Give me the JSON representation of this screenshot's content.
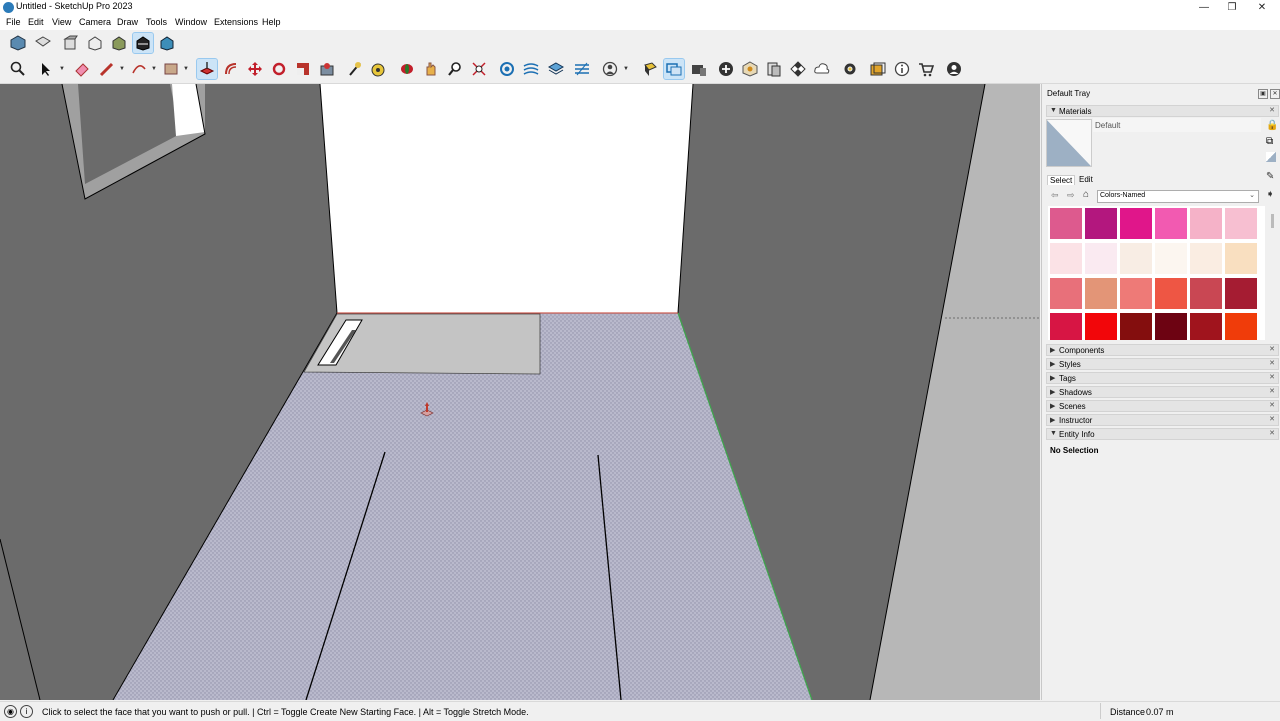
{
  "window": {
    "title": "Untitled - SketchUp Pro 2023"
  },
  "menu": [
    "File",
    "Edit",
    "View",
    "Camera",
    "Draw",
    "Tools",
    "Window",
    "Extensions",
    "Help"
  ],
  "toolbar_top": [
    "iso-view-icon",
    "top-view-icon",
    "front-view-icon",
    "right-view-icon",
    "back-view-icon",
    "left-view-icon",
    "bottom-view-icon"
  ],
  "toolbar_main": [
    "search-icon",
    "select-icon",
    "eraser-icon",
    "pencil-icon",
    "arc-icon",
    "rectangle-icon",
    "push-pull-icon",
    "offset-icon",
    "move-icon",
    "rotate-icon",
    "scale-icon",
    "follow-me-icon",
    "tape-measure-icon",
    "paint-bucket-icon",
    "orbit-icon",
    "pan-icon",
    "zoom-icon",
    "zoom-extents-icon",
    "section-plane-icon",
    "sandbox-icon",
    "layers-icon",
    "styles-icon",
    "profile-icon",
    "components-icon",
    "scenes-icon",
    "materials-icon",
    "add-location-icon",
    "geo-icon",
    "book-icon",
    "checker-icon",
    "cloud-icon",
    "extension-icon",
    "folder-icon",
    "info-icon",
    "cart-icon",
    "account-icon"
  ],
  "tray": {
    "title": "Default Tray",
    "materials": {
      "header": "Materials",
      "current_name": "Default",
      "tabs": [
        "Select",
        "Edit"
      ],
      "library": "Colors-Named",
      "swatch_colors": [
        [
          "#dd5a8e",
          "#b3177e",
          "#e0168a",
          "#f25ab1",
          "#f5b2c8",
          "#f7bfd1"
        ],
        [
          "#fbe2e6",
          "#faeaf1",
          "#f8ede4",
          "#fcf6f0",
          "#faede2",
          "#f9dfc0"
        ],
        [
          "#e8707a",
          "#e39577",
          "#ee7a77",
          "#ee5644",
          "#c94753",
          "#a51c32"
        ],
        [
          "#d71544",
          "#f2060a",
          "#840e0e",
          "#6d0312",
          "#a0141d",
          "#f03c0a"
        ]
      ]
    },
    "panels": [
      "Components",
      "Styles",
      "Tags",
      "Shadows",
      "Scenes",
      "Instructor",
      "Entity Info"
    ],
    "entity_info": "No Selection"
  },
  "status": {
    "message": "Click to select the face that you want to push or pull. | Ctrl = Toggle Create New Starting Face. | Alt = Toggle Stretch Mode.",
    "measure_label": "Distance",
    "measure_value": "0.07 m"
  },
  "colors": {
    "wall": "#6b6b6b",
    "floor": "#b9b9cc",
    "accent": "#2b7bb9"
  }
}
